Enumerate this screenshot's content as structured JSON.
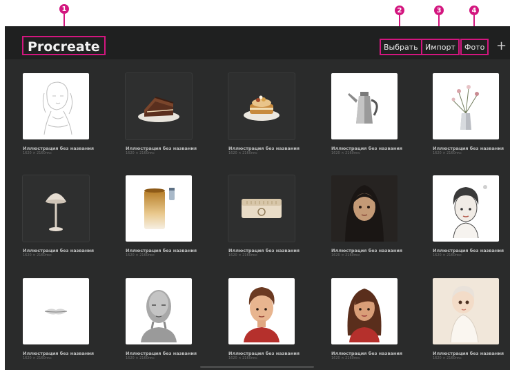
{
  "header": {
    "title": "Procreate",
    "buttons": {
      "select": "Выбрать",
      "import": "Импорт",
      "photo": "Фото"
    },
    "add_icon": "+"
  },
  "markers": [
    "1",
    "2",
    "3",
    "4"
  ],
  "accent_color": "#d3167f",
  "gallery": {
    "items": [
      {
        "name": "Иллюстрация без названия",
        "size": "1620 × 2160пкс",
        "icon": "girl-sketch"
      },
      {
        "name": "Иллюстрация без названия",
        "size": "1620 × 2160пкс",
        "icon": "cake-slice"
      },
      {
        "name": "Иллюстрация без названия",
        "size": "1620 × 2160пкс",
        "icon": "cake-plate"
      },
      {
        "name": "Иллюстрация без названия",
        "size": "1620 × 2160пкс",
        "icon": "teapot"
      },
      {
        "name": "Иллюстрация без названия",
        "size": "1620 × 2160пкс",
        "icon": "flower-vase"
      },
      {
        "name": "Иллюстрация без названия",
        "size": "1620 × 2160пкс",
        "icon": "lamp"
      },
      {
        "name": "Иллюстрация без названия",
        "size": "1620 × 2160пкс",
        "icon": "tin-can"
      },
      {
        "name": "Иллюстрация без названия",
        "size": "1620 × 2160пкс",
        "icon": "radio"
      },
      {
        "name": "Иллюстрация без названия",
        "size": "1620 × 2160пкс",
        "icon": "woman-portrait"
      },
      {
        "name": "Иллюстрация без названия",
        "size": "1620 × 2160пкс",
        "icon": "boy-head"
      },
      {
        "name": "Иллюстрация без названия",
        "size": "1620 × 2160пкс",
        "icon": "lips"
      },
      {
        "name": "Иллюстрация без названия",
        "size": "1620 × 2160пкс",
        "icon": "grey-head"
      },
      {
        "name": "Иллюстрация без названия",
        "size": "1620 × 2160пкс",
        "icon": "man-portrait"
      },
      {
        "name": "Иллюстрация без названия",
        "size": "1620 × 2160пкс",
        "icon": "woman-portrait-2"
      },
      {
        "name": "Иллюстрация без названия",
        "size": "1620 × 2160пкс",
        "icon": "baby-girl"
      }
    ]
  }
}
